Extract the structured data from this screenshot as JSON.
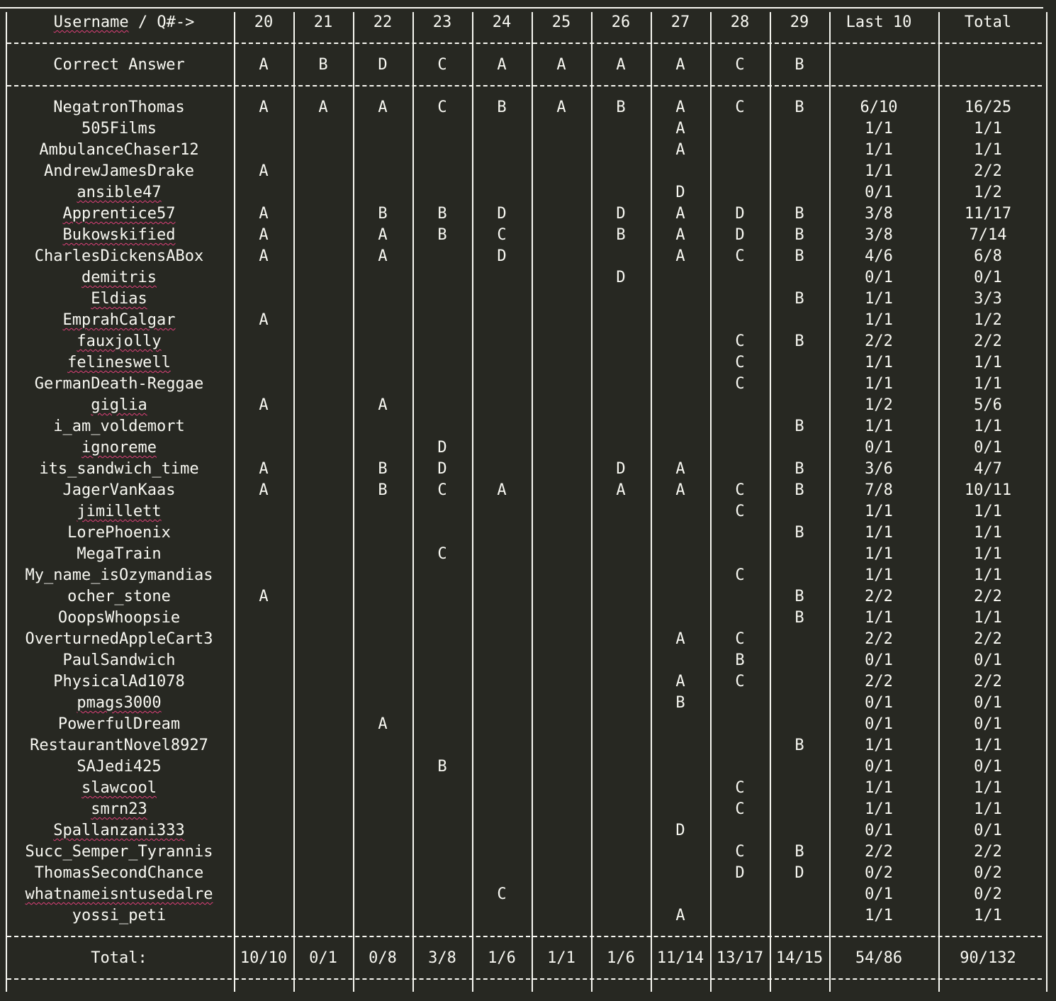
{
  "header": {
    "username_label": "Username / Q#->",
    "questions": [
      "20",
      "21",
      "22",
      "23",
      "24",
      "25",
      "26",
      "27",
      "28",
      "29"
    ],
    "last10_label": "Last 10",
    "total_label": "Total"
  },
  "correct": {
    "label": "Correct Answer",
    "answers": [
      "A",
      "B",
      "D",
      "C",
      "A",
      "A",
      "A",
      "A",
      "C",
      "B"
    ]
  },
  "rows": [
    {
      "name": "NegatronThomas",
      "answers": [
        "A",
        "A",
        "A",
        "C",
        "B",
        "A",
        "B",
        "A",
        "C",
        "B"
      ],
      "last10": "6/10",
      "total": "16/25",
      "spell": false
    },
    {
      "name": "505Films",
      "answers": [
        "",
        "",
        "",
        "",
        "",
        "",
        "",
        "A",
        "",
        ""
      ],
      "last10": "1/1",
      "total": "1/1",
      "spell": false
    },
    {
      "name": "AmbulanceChaser12",
      "answers": [
        "",
        "",
        "",
        "",
        "",
        "",
        "",
        "A",
        "",
        ""
      ],
      "last10": "1/1",
      "total": "1/1",
      "spell": false
    },
    {
      "name": "AndrewJamesDrake",
      "answers": [
        "A",
        "",
        "",
        "",
        "",
        "",
        "",
        "",
        "",
        ""
      ],
      "last10": "1/1",
      "total": "2/2",
      "spell": false
    },
    {
      "name": "ansible47",
      "answers": [
        "",
        "",
        "",
        "",
        "",
        "",
        "",
        "D",
        "",
        ""
      ],
      "last10": "0/1",
      "total": "1/2",
      "spell": true
    },
    {
      "name": "Apprentice57",
      "answers": [
        "A",
        "",
        "B",
        "B",
        "D",
        "",
        "D",
        "A",
        "D",
        "B"
      ],
      "last10": "3/8",
      "total": "11/17",
      "spell": true
    },
    {
      "name": "Bukowskified",
      "answers": [
        "A",
        "",
        "A",
        "B",
        "C",
        "",
        "B",
        "A",
        "D",
        "B"
      ],
      "last10": "3/8",
      "total": "7/14",
      "spell": true
    },
    {
      "name": "CharlesDickensABox",
      "answers": [
        "A",
        "",
        "A",
        "",
        "D",
        "",
        "",
        "A",
        "C",
        "B"
      ],
      "last10": "4/6",
      "total": "6/8",
      "spell": false
    },
    {
      "name": "demitris",
      "answers": [
        "",
        "",
        "",
        "",
        "",
        "",
        "D",
        "",
        "",
        ""
      ],
      "last10": "0/1",
      "total": "0/1",
      "spell": true
    },
    {
      "name": "Eldias",
      "answers": [
        "",
        "",
        "",
        "",
        "",
        "",
        "",
        "",
        "",
        "B"
      ],
      "last10": "1/1",
      "total": "3/3",
      "spell": true
    },
    {
      "name": "EmprahCalgar",
      "answers": [
        "A",
        "",
        "",
        "",
        "",
        "",
        "",
        "",
        "",
        ""
      ],
      "last10": "1/1",
      "total": "1/2",
      "spell": true
    },
    {
      "name": "fauxjolly",
      "answers": [
        "",
        "",
        "",
        "",
        "",
        "",
        "",
        "",
        "C",
        "B"
      ],
      "last10": "2/2",
      "total": "2/2",
      "spell": true
    },
    {
      "name": "felineswell",
      "answers": [
        "",
        "",
        "",
        "",
        "",
        "",
        "",
        "",
        "C",
        ""
      ],
      "last10": "1/1",
      "total": "1/1",
      "spell": true
    },
    {
      "name": "GermanDeath-Reggae",
      "answers": [
        "",
        "",
        "",
        "",
        "",
        "",
        "",
        "",
        "C",
        ""
      ],
      "last10": "1/1",
      "total": "1/1",
      "spell": false
    },
    {
      "name": "giglia",
      "answers": [
        "A",
        "",
        "A",
        "",
        "",
        "",
        "",
        "",
        "",
        ""
      ],
      "last10": "1/2",
      "total": "5/6",
      "spell": true
    },
    {
      "name": "i_am_voldemort",
      "answers": [
        "",
        "",
        "",
        "",
        "",
        "",
        "",
        "",
        "",
        "B"
      ],
      "last10": "1/1",
      "total": "1/1",
      "spell": false
    },
    {
      "name": "ignoreme",
      "answers": [
        "",
        "",
        "",
        "D",
        "",
        "",
        "",
        "",
        "",
        ""
      ],
      "last10": "0/1",
      "total": "0/1",
      "spell": true
    },
    {
      "name": "its_sandwich_time",
      "answers": [
        "A",
        "",
        "B",
        "D",
        "",
        "",
        "D",
        "A",
        "",
        "B"
      ],
      "last10": "3/6",
      "total": "4/7",
      "spell": false
    },
    {
      "name": "JagerVanKaas",
      "answers": [
        "A",
        "",
        "B",
        "C",
        "A",
        "",
        "A",
        "A",
        "C",
        "B"
      ],
      "last10": "7/8",
      "total": "10/11",
      "spell": false
    },
    {
      "name": "jimillett",
      "answers": [
        "",
        "",
        "",
        "",
        "",
        "",
        "",
        "",
        "C",
        ""
      ],
      "last10": "1/1",
      "total": "1/1",
      "spell": true
    },
    {
      "name": "LorePhoenix",
      "answers": [
        "",
        "",
        "",
        "",
        "",
        "",
        "",
        "",
        "",
        "B"
      ],
      "last10": "1/1",
      "total": "1/1",
      "spell": false
    },
    {
      "name": "MegaTrain",
      "answers": [
        "",
        "",
        "",
        "C",
        "",
        "",
        "",
        "",
        "",
        ""
      ],
      "last10": "1/1",
      "total": "1/1",
      "spell": false
    },
    {
      "name": "My_name_isOzymandias",
      "answers": [
        "",
        "",
        "",
        "",
        "",
        "",
        "",
        "",
        "C",
        ""
      ],
      "last10": "1/1",
      "total": "1/1",
      "spell": false
    },
    {
      "name": "ocher_stone",
      "answers": [
        "A",
        "",
        "",
        "",
        "",
        "",
        "",
        "",
        "",
        "B"
      ],
      "last10": "2/2",
      "total": "2/2",
      "spell": false
    },
    {
      "name": "OoopsWhoopsie",
      "answers": [
        "",
        "",
        "",
        "",
        "",
        "",
        "",
        "",
        "",
        "B"
      ],
      "last10": "1/1",
      "total": "1/1",
      "spell": false
    },
    {
      "name": "OverturnedAppleCart3",
      "answers": [
        "",
        "",
        "",
        "",
        "",
        "",
        "",
        "A",
        "C",
        ""
      ],
      "last10": "2/2",
      "total": "2/2",
      "spell": false
    },
    {
      "name": "PaulSandwich",
      "answers": [
        "",
        "",
        "",
        "",
        "",
        "",
        "",
        "",
        "B",
        ""
      ],
      "last10": "0/1",
      "total": "0/1",
      "spell": false
    },
    {
      "name": "PhysicalAd1078",
      "answers": [
        "",
        "",
        "",
        "",
        "",
        "",
        "",
        "A",
        "C",
        ""
      ],
      "last10": "2/2",
      "total": "2/2",
      "spell": false
    },
    {
      "name": "pmags3000",
      "answers": [
        "",
        "",
        "",
        "",
        "",
        "",
        "",
        "B",
        "",
        ""
      ],
      "last10": "0/1",
      "total": "0/1",
      "spell": true
    },
    {
      "name": "PowerfulDream",
      "answers": [
        "",
        "",
        "A",
        "",
        "",
        "",
        "",
        "",
        "",
        ""
      ],
      "last10": "0/1",
      "total": "0/1",
      "spell": false
    },
    {
      "name": "RestaurantNovel8927",
      "answers": [
        "",
        "",
        "",
        "",
        "",
        "",
        "",
        "",
        "",
        "B"
      ],
      "last10": "1/1",
      "total": "1/1",
      "spell": false
    },
    {
      "name": "SAJedi425",
      "answers": [
        "",
        "",
        "",
        "B",
        "",
        "",
        "",
        "",
        "",
        ""
      ],
      "last10": "0/1",
      "total": "0/1",
      "spell": false
    },
    {
      "name": "slawcool",
      "answers": [
        "",
        "",
        "",
        "",
        "",
        "",
        "",
        "",
        "C",
        ""
      ],
      "last10": "1/1",
      "total": "1/1",
      "spell": true
    },
    {
      "name": "smrn23",
      "answers": [
        "",
        "",
        "",
        "",
        "",
        "",
        "",
        "",
        "C",
        ""
      ],
      "last10": "1/1",
      "total": "1/1",
      "spell": true
    },
    {
      "name": "Spallanzani333",
      "answers": [
        "",
        "",
        "",
        "",
        "",
        "",
        "",
        "D",
        "",
        ""
      ],
      "last10": "0/1",
      "total": "0/1",
      "spell": true
    },
    {
      "name": "Succ_Semper_Tyrannis",
      "answers": [
        "",
        "",
        "",
        "",
        "",
        "",
        "",
        "",
        "C",
        "B"
      ],
      "last10": "2/2",
      "total": "2/2",
      "spell": false
    },
    {
      "name": "ThomasSecondChance",
      "answers": [
        "",
        "",
        "",
        "",
        "",
        "",
        "",
        "",
        "D",
        "D"
      ],
      "last10": "0/2",
      "total": "0/2",
      "spell": false
    },
    {
      "name": "whatnameisntusedalre",
      "answers": [
        "",
        "",
        "",
        "",
        "C",
        "",
        "",
        "",
        "",
        ""
      ],
      "last10": "0/1",
      "total": "0/2",
      "spell": true
    },
    {
      "name": "yossi_peti",
      "answers": [
        "",
        "",
        "",
        "",
        "",
        "",
        "",
        "A",
        "",
        ""
      ],
      "last10": "1/1",
      "total": "1/1",
      "spell": false
    }
  ],
  "totals": {
    "label": "Total:",
    "per_question": [
      "10/10",
      "0/1",
      "0/8",
      "3/8",
      "1/6",
      "1/1",
      "1/6",
      "11/14",
      "13/17",
      "14/15"
    ],
    "last10": "54/86",
    "total": "90/132"
  },
  "colors": {
    "background": "#272822",
    "text": "#f8f8f2",
    "spellcheck_underline": "#e0407a"
  }
}
